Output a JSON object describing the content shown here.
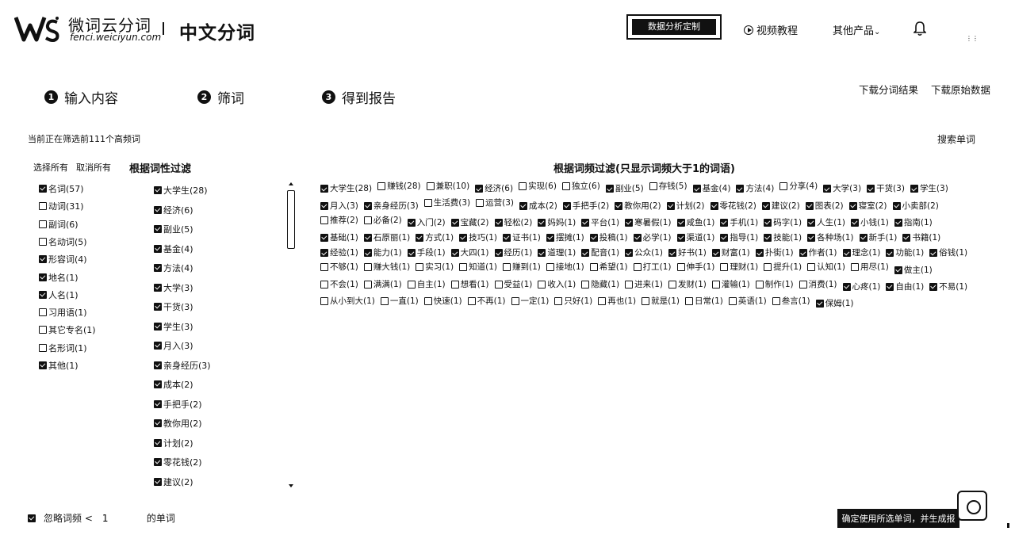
{
  "header": {
    "logo_name": "微词云分词",
    "logo_url": "fenci.weiciyun.com",
    "page_name": "中文分词",
    "custom_button": "数据分析定制",
    "video_tutorial": "视频教程",
    "other_products": "其他产品"
  },
  "steps": [
    {
      "num": "1",
      "label": "输入内容"
    },
    {
      "num": "2",
      "label": "筛词"
    },
    {
      "num": "3",
      "label": "得到报告"
    }
  ],
  "downloads": {
    "segmentation": "下载分词结果",
    "raw": "下载原始数据"
  },
  "filter_status": "当前正在筛选前111个高频词",
  "search_word": "搜索单词",
  "select_all": "选择所有",
  "deselect_all": "取消所有",
  "pos_filter_title": "根据词性过滤",
  "pos_filters": [
    {
      "label": "名词(57)",
      "checked": true
    },
    {
      "label": "动词(31)",
      "checked": false
    },
    {
      "label": "副词(6)",
      "checked": false
    },
    {
      "label": "名动词(5)",
      "checked": false
    },
    {
      "label": "形容词(4)",
      "checked": true
    },
    {
      "label": "地名(1)",
      "checked": true
    },
    {
      "label": "人名(1)",
      "checked": true
    },
    {
      "label": "习用语(1)",
      "checked": false
    },
    {
      "label": "其它专名(1)",
      "checked": false
    },
    {
      "label": "名形词(1)",
      "checked": false
    },
    {
      "label": "其他(1)",
      "checked": true
    }
  ],
  "word_list": [
    {
      "label": "大学生(28)",
      "checked": true
    },
    {
      "label": "经济(6)",
      "checked": true
    },
    {
      "label": "副业(5)",
      "checked": true
    },
    {
      "label": "基金(4)",
      "checked": true
    },
    {
      "label": "方法(4)",
      "checked": true
    },
    {
      "label": "大学(3)",
      "checked": true
    },
    {
      "label": "干货(3)",
      "checked": true
    },
    {
      "label": "学生(3)",
      "checked": true
    },
    {
      "label": "月入(3)",
      "checked": true
    },
    {
      "label": "亲身经历(3)",
      "checked": true
    },
    {
      "label": "成本(2)",
      "checked": true
    },
    {
      "label": "手把手(2)",
      "checked": true
    },
    {
      "label": "教你用(2)",
      "checked": true
    },
    {
      "label": "计划(2)",
      "checked": true
    },
    {
      "label": "零花钱(2)",
      "checked": true
    },
    {
      "label": "建议(2)",
      "checked": true
    }
  ],
  "freq_filter_title": "根据词频过滤(只显示词频大于1的词语)",
  "freq_words": [
    {
      "label": "大学生(28)",
      "checked": true
    },
    {
      "label": "赚钱(28)",
      "checked": false
    },
    {
      "label": "兼职(10)",
      "checked": false
    },
    {
      "label": "经济(6)",
      "checked": true
    },
    {
      "label": "实现(6)",
      "checked": false
    },
    {
      "label": "独立(6)",
      "checked": false
    },
    {
      "label": "副业(5)",
      "checked": true
    },
    {
      "label": "存钱(5)",
      "checked": false
    },
    {
      "label": "基金(4)",
      "checked": true
    },
    {
      "label": "方法(4)",
      "checked": true
    },
    {
      "label": "分享(4)",
      "checked": false
    },
    {
      "label": "大学(3)",
      "checked": true
    },
    {
      "label": "干货(3)",
      "checked": true
    },
    {
      "label": "学生(3)",
      "checked": true
    },
    {
      "label": "月入(3)",
      "checked": true
    },
    {
      "label": "亲身经历(3)",
      "checked": true
    },
    {
      "label": "生活费(3)",
      "checked": false
    },
    {
      "label": "运营(3)",
      "checked": false
    },
    {
      "label": "成本(2)",
      "checked": true
    },
    {
      "label": "手把手(2)",
      "checked": true
    },
    {
      "label": "教你用(2)",
      "checked": true
    },
    {
      "label": "计划(2)",
      "checked": true
    },
    {
      "label": "零花钱(2)",
      "checked": true
    },
    {
      "label": "建议(2)",
      "checked": true
    },
    {
      "label": "图表(2)",
      "checked": true
    },
    {
      "label": "寝室(2)",
      "checked": true
    },
    {
      "label": "小卖部(2)",
      "checked": true
    },
    {
      "label": "推荐(2)",
      "checked": false
    },
    {
      "label": "必备(2)",
      "checked": false
    },
    {
      "label": "入门(2)",
      "checked": true
    },
    {
      "label": "宝藏(2)",
      "checked": true
    },
    {
      "label": "轻松(2)",
      "checked": true
    },
    {
      "label": "妈妈(1)",
      "checked": true
    },
    {
      "label": "平台(1)",
      "checked": true
    },
    {
      "label": "寒暑假(1)",
      "checked": true
    },
    {
      "label": "咸鱼(1)",
      "checked": true
    },
    {
      "label": "手机(1)",
      "checked": true
    },
    {
      "label": "码字(1)",
      "checked": true
    },
    {
      "label": "人生(1)",
      "checked": true
    },
    {
      "label": "小钱(1)",
      "checked": true
    },
    {
      "label": "指南(1)",
      "checked": true
    },
    {
      "label": "基础(1)",
      "checked": true
    },
    {
      "label": "石原丽(1)",
      "checked": true
    },
    {
      "label": "方式(1)",
      "checked": true
    },
    {
      "label": "技巧(1)",
      "checked": true
    },
    {
      "label": "证书(1)",
      "checked": true
    },
    {
      "label": "摆摊(1)",
      "checked": true
    },
    {
      "label": "投稿(1)",
      "checked": true
    },
    {
      "label": "必学(1)",
      "checked": true
    },
    {
      "label": "渠道(1)",
      "checked": true
    },
    {
      "label": "指导(1)",
      "checked": true
    },
    {
      "label": "技能(1)",
      "checked": true
    },
    {
      "label": "各种场(1)",
      "checked": true
    },
    {
      "label": "新手(1)",
      "checked": true
    },
    {
      "label": "书籍(1)",
      "checked": true
    },
    {
      "label": "经验(1)",
      "checked": true
    },
    {
      "label": "能力(1)",
      "checked": true
    },
    {
      "label": "手段(1)",
      "checked": true
    },
    {
      "label": "大四(1)",
      "checked": true
    },
    {
      "label": "经历(1)",
      "checked": true
    },
    {
      "label": "道理(1)",
      "checked": true
    },
    {
      "label": "配音(1)",
      "checked": true
    },
    {
      "label": "公众(1)",
      "checked": true
    },
    {
      "label": "好书(1)",
      "checked": true
    },
    {
      "label": "财富(1)",
      "checked": true
    },
    {
      "label": "扑街(1)",
      "checked": true
    },
    {
      "label": "作者(1)",
      "checked": true
    },
    {
      "label": "理念(1)",
      "checked": true
    },
    {
      "label": "功能(1)",
      "checked": true
    },
    {
      "label": "俗钱(1)",
      "checked": true
    },
    {
      "label": "不够(1)",
      "checked": false
    },
    {
      "label": "赚大钱(1)",
      "checked": false
    },
    {
      "label": "实习(1)",
      "checked": false
    },
    {
      "label": "知道(1)",
      "checked": false
    },
    {
      "label": "赚到(1)",
      "checked": false
    },
    {
      "label": "接地(1)",
      "checked": false
    },
    {
      "label": "希望(1)",
      "checked": false
    },
    {
      "label": "打工(1)",
      "checked": false
    },
    {
      "label": "伸手(1)",
      "checked": false
    },
    {
      "label": "理财(1)",
      "checked": false
    },
    {
      "label": "提升(1)",
      "checked": false
    },
    {
      "label": "认知(1)",
      "checked": false
    },
    {
      "label": "用尽(1)",
      "checked": false
    },
    {
      "label": "做主(1)",
      "checked": true
    },
    {
      "label": "不会(1)",
      "checked": false
    },
    {
      "label": "满满(1)",
      "checked": false
    },
    {
      "label": "自主(1)",
      "checked": false
    },
    {
      "label": "想看(1)",
      "checked": false
    },
    {
      "label": "受益(1)",
      "checked": false
    },
    {
      "label": "收入(1)",
      "checked": false
    },
    {
      "label": "隐藏(1)",
      "checked": false
    },
    {
      "label": "进来(1)",
      "checked": false
    },
    {
      "label": "发财(1)",
      "checked": false
    },
    {
      "label": "灌输(1)",
      "checked": false
    },
    {
      "label": "制作(1)",
      "checked": false
    },
    {
      "label": "消费(1)",
      "checked": false
    },
    {
      "label": "心疼(1)",
      "checked": true
    },
    {
      "label": "自由(1)",
      "checked": true
    },
    {
      "label": "不易(1)",
      "checked": true
    },
    {
      "label": "从小到大(1)",
      "checked": false
    },
    {
      "label": "一直(1)",
      "checked": false
    },
    {
      "label": "快速(1)",
      "checked": false
    },
    {
      "label": "不再(1)",
      "checked": false
    },
    {
      "label": "一定(1)",
      "checked": false
    },
    {
      "label": "只好(1)",
      "checked": false
    },
    {
      "label": "再也(1)",
      "checked": false
    },
    {
      "label": "就是(1)",
      "checked": false
    },
    {
      "label": "日常(1)",
      "checked": false
    },
    {
      "label": "英语(1)",
      "checked": false
    },
    {
      "label": "叁言(1)",
      "checked": false
    },
    {
      "label": "保姆(1)",
      "checked": true
    }
  ],
  "ignore_prefix": "忽略词频 <",
  "ignore_value": "1",
  "ignore_suffix": "的单词",
  "confirm_button": "确定使用所选单词，并生成报"
}
